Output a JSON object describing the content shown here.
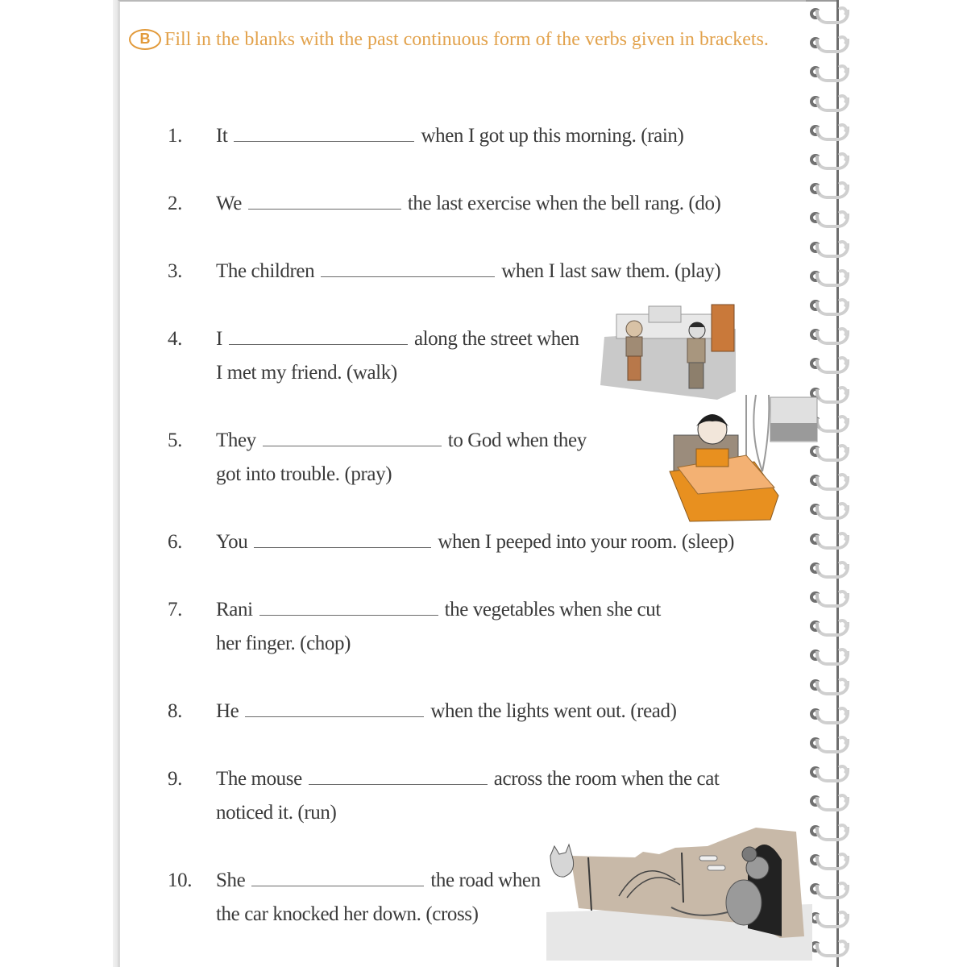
{
  "section": {
    "badge": "B",
    "instruction": "Fill in the blanks with the past continuous form of the verbs given in brackets."
  },
  "questions": [
    {
      "num": "1.",
      "before": "It",
      "after": "when I got up this morning. (rain)",
      "cont": "",
      "answer": ""
    },
    {
      "num": "2.",
      "before": "We",
      "after": "the last exercise when the bell rang. (do)",
      "cont": "",
      "answer": ""
    },
    {
      "num": "3.",
      "before": "The children",
      "after": "when I last saw them. (play)",
      "cont": "",
      "answer": ""
    },
    {
      "num": "4.",
      "before": "I",
      "after": "along the street when",
      "cont": "I met my friend. (walk)",
      "answer": ""
    },
    {
      "num": "5.",
      "before": "They",
      "after": "to God when they",
      "cont": "got into trouble. (pray)",
      "answer": ""
    },
    {
      "num": "6.",
      "before": "You",
      "after": "when I peeped into your room. (sleep)",
      "cont": "",
      "answer": ""
    },
    {
      "num": "7.",
      "before": "Rani",
      "after": "the vegetables when she cut",
      "cont": "her finger. (chop)",
      "answer": ""
    },
    {
      "num": "8.",
      "before": "He",
      "after": "when the lights went out. (read)",
      "cont": "",
      "answer": ""
    },
    {
      "num": "9.",
      "before": "The mouse",
      "after": "across the room when the cat",
      "cont": "noticed it. (run)",
      "answer": ""
    },
    {
      "num": "10.",
      "before": "She",
      "after": "the road when",
      "cont": "the car knocked her down. (cross)",
      "answer": ""
    }
  ],
  "illustrations": [
    {
      "name": "boys-meeting-on-street-illustration"
    },
    {
      "name": "boy-sleeping-in-bed-illustration"
    },
    {
      "name": "mouse-running-to-hole-illustration"
    }
  ],
  "colors": {
    "heading": "#e2a44f",
    "text": "#3a3a3a",
    "accent_orange": "#e8901f"
  }
}
